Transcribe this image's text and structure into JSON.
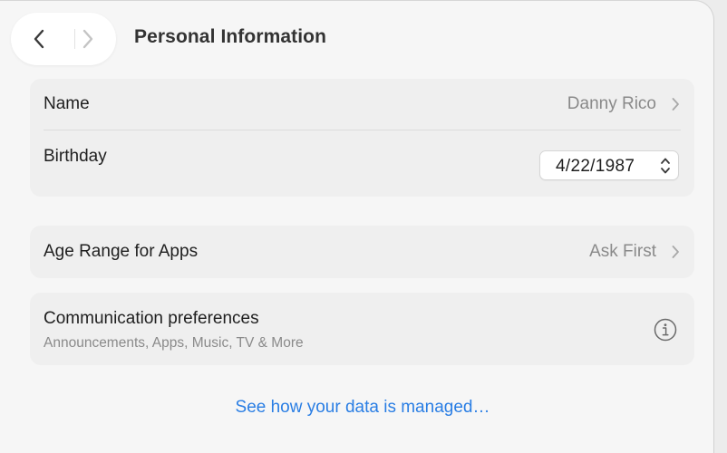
{
  "header": {
    "title": "Personal Information"
  },
  "personal_card": {
    "name_label": "Name",
    "name_value": "Danny Rico",
    "birthday_label": "Birthday",
    "birthday_value": "4/22/1987"
  },
  "age_card": {
    "label": "Age Range for Apps",
    "value": "Ask First"
  },
  "comm_card": {
    "label": "Communication preferences",
    "subtitle": "Announcements, Apps, Music, TV & More"
  },
  "footer": {
    "link_label": "See how your data is managed…"
  },
  "colors": {
    "accent": "#2a7ee4",
    "secondary_text": "#8a8a8a",
    "card_background": "#efefef"
  },
  "icons": {
    "back": "chevron-left-icon",
    "forward": "chevron-right-icon",
    "row_disclosure": "chevron-right-icon",
    "stepper": "up-down-chevron-icon",
    "info": "info-circle-icon"
  }
}
